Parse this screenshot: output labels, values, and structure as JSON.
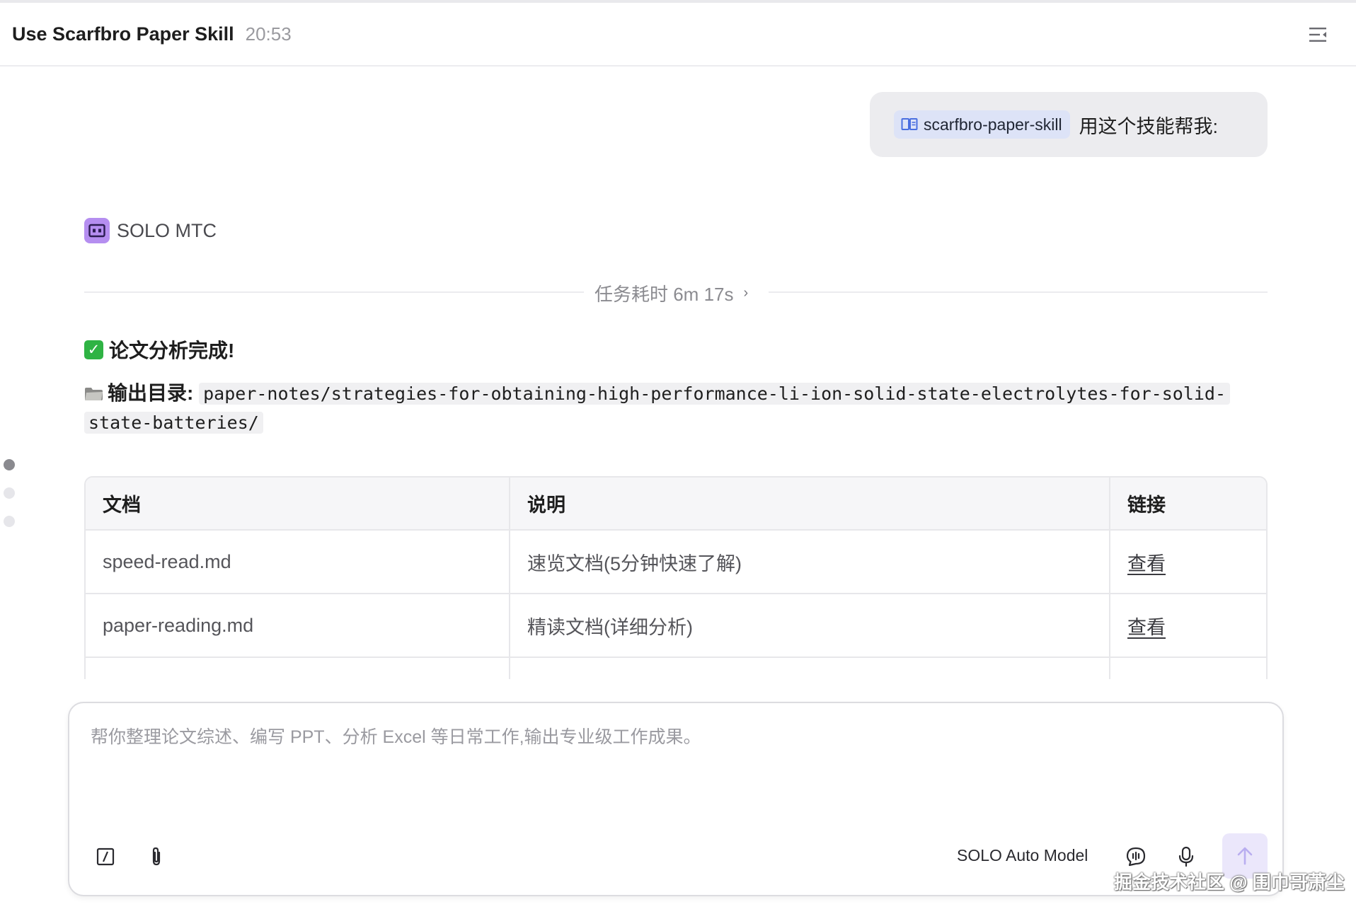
{
  "header": {
    "title": "Use Scarfbro Paper Skill",
    "time": "20:53"
  },
  "user_message": {
    "skill_chip": "scarfbro-paper-skill",
    "text": "用这个技能帮我:"
  },
  "agent": {
    "name": "SOLO MTC",
    "duration": "任务耗时 6m 17s"
  },
  "result": {
    "done_title": "论文分析完成!",
    "output_label": "输出目录:",
    "output_path": "paper-notes/strategies-for-obtaining-high-performance-li-ion-solid-state-electrolytes-for-solid-state-batteries/"
  },
  "table": {
    "headers": [
      "文档",
      "说明",
      "链接"
    ],
    "rows": [
      {
        "doc": "speed-read.md",
        "desc": "速览文档(5分钟快速了解)",
        "link": "查看"
      },
      {
        "doc": "paper-reading.md",
        "desc": "精读文档(详细分析)",
        "link": "查看"
      }
    ]
  },
  "composer": {
    "placeholder": "帮你整理论文综述、编写 PPT、分析 Excel 等日常工作,输出专业级工作成果。",
    "value": "",
    "model": "SOLO Auto Model"
  },
  "watermark": "掘金技术社区 @ 围巾哥萧尘",
  "icons": {
    "header_menu": "menu-collapse-icon",
    "skill": "book-icon",
    "agent": "robot-icon",
    "slash": "slash-command-icon",
    "attach": "paperclip-icon",
    "voice_chat": "voice-chat-icon",
    "mic": "microphone-icon",
    "send": "arrow-up-icon"
  },
  "colors": {
    "agent_icon": "#b58ef0",
    "skill_chip_bg": "#dde3f7",
    "check_green": "#2fb344",
    "send_bg": "#ebe7fb"
  }
}
